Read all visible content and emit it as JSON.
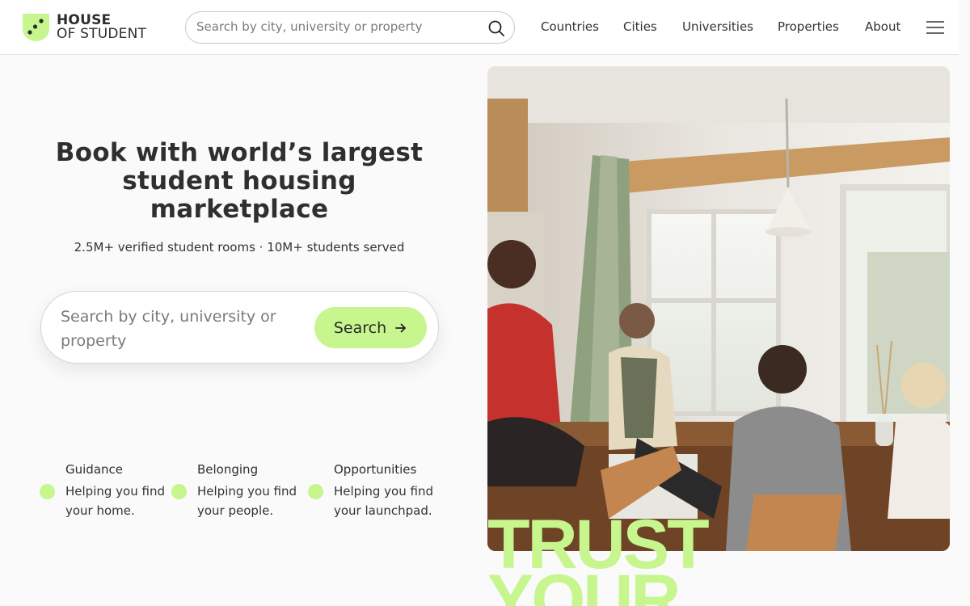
{
  "brand": {
    "line1": "HOUSE",
    "line2": "OF STUDENT",
    "accent": "#c6f68d"
  },
  "header": {
    "search_placeholder": "Search by city, university or property",
    "nav": [
      {
        "label": "Countries"
      },
      {
        "label": "Cities"
      },
      {
        "label": "Universities"
      },
      {
        "label": "Properties"
      },
      {
        "label": "About"
      }
    ]
  },
  "hero": {
    "title_lines": [
      "Book with world’s largest",
      "student housing",
      "marketplace"
    ],
    "subtitle": "2.5M+ verified student rooms · 10M+ students served",
    "search_placeholder": "Search by city, university or property",
    "search_button": "Search",
    "image_overlay": {
      "line1": "TRUST",
      "line2": "YOUR"
    }
  },
  "features": [
    {
      "title": "Guidance",
      "desc": "Helping you find your home."
    },
    {
      "title": "Belonging",
      "desc": "Helping you find your people."
    },
    {
      "title": "Opportunities",
      "desc": "Helping you find your launchpad."
    }
  ]
}
